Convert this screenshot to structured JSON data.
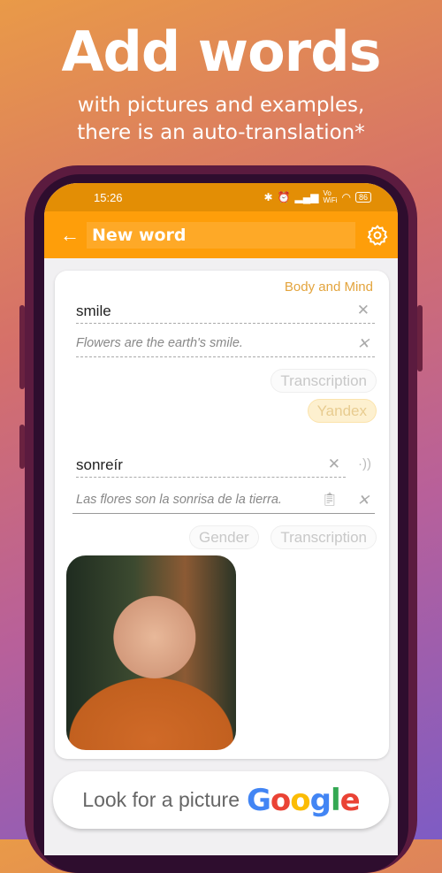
{
  "promo": {
    "title": "Add words",
    "subtitle_line1": "with pictures and examples,",
    "subtitle_line2": "there is an auto-translation*"
  },
  "status_bar": {
    "time": "15:26",
    "battery": "86",
    "icons": [
      "bluetooth-icon",
      "alarm-icon",
      "signal-icon",
      "vowifi-icon",
      "wifi-icon",
      "battery-icon"
    ]
  },
  "app_bar": {
    "title": "New word",
    "back_icon": "arrow-left-icon",
    "settings_icon": "gear-icon"
  },
  "card": {
    "category": "Body and Mind",
    "word": "smile",
    "example": "Flowers are the earth's smile.",
    "transcription_label": "Transcription",
    "yandex_label": "Yandex",
    "translation": "sonreír",
    "translation_example": "Las flores son la sonrisa de la tierra.",
    "gender_label": "Gender",
    "transcription2_label": "Transcription"
  },
  "picture_button": {
    "label": "Look for a picture",
    "brand": [
      "G",
      "o",
      "o",
      "g",
      "l",
      "e"
    ],
    "brand_colors": [
      "#4285F4",
      "#EA4335",
      "#FBBC05",
      "#4285F4",
      "#34A853",
      "#EA4335"
    ]
  },
  "colors": {
    "accent": "#fe9e0a",
    "category": "#e3a43d"
  }
}
